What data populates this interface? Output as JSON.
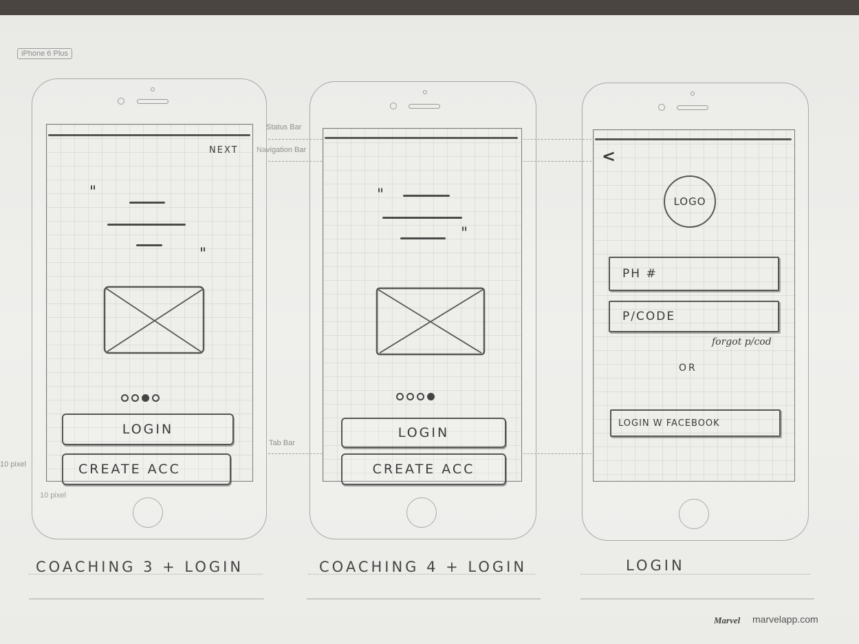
{
  "device_tag": "iPhone 6 Plus",
  "annotations": {
    "status_bar": "Status Bar",
    "navigation_bar": "Navigation Bar",
    "tab_bar": "Tab Bar",
    "margin_left": "10 pixel",
    "margin_bottom": "10 pixel"
  },
  "screens": [
    {
      "nav_action": "NEXT",
      "quote_open": "\"",
      "quote_close": "\"",
      "login_button": "LOGIN",
      "create_button": "CREATE ACC",
      "caption": "COACHING 3 + LOGIN",
      "pager_active_index": 3
    },
    {
      "quote_open": "\"",
      "quote_close": "\"",
      "login_button": "LOGIN",
      "create_button": "CREATE ACC",
      "caption": "COACHING 4 + LOGIN",
      "pager_active_index": 4
    },
    {
      "back_icon": "<",
      "logo": "LOGO",
      "phone_field": "PH #",
      "password_field": "P/CODE",
      "forgot_link": "forgot p/cod",
      "or_label": "OR",
      "facebook_button": "LOGIN W FACEBOOK",
      "caption": "LOGIN"
    }
  ],
  "footer": {
    "brand_logo": "Marvel",
    "brand_url": "marvelapp.com"
  }
}
